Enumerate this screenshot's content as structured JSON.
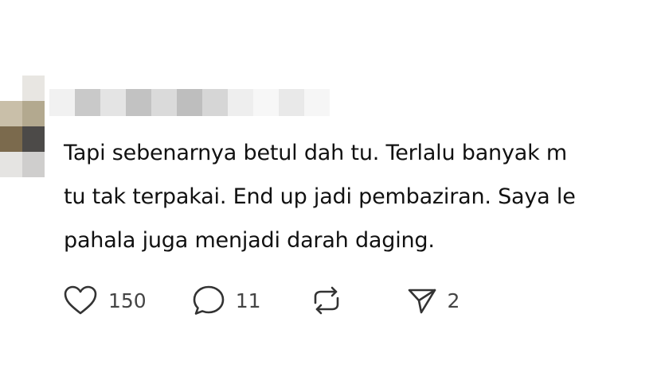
{
  "post": {
    "lines": [
      "Tapi sebenarnya betul dah tu. Terlalu banyak m",
      "tu tak terpakai. End up jadi pembaziran. Saya le",
      "pahala juga menjadi darah daging."
    ]
  },
  "actions": {
    "like_count": "150",
    "reply_count": "11",
    "share_count": "2"
  },
  "icons": {
    "like": "heart-icon",
    "reply": "comment-bubble-icon",
    "repost": "repost-icon",
    "share": "send-icon"
  },
  "colors": {
    "text": "#111111",
    "icon": "#333333",
    "count": "#444444",
    "background": "#ffffff"
  }
}
